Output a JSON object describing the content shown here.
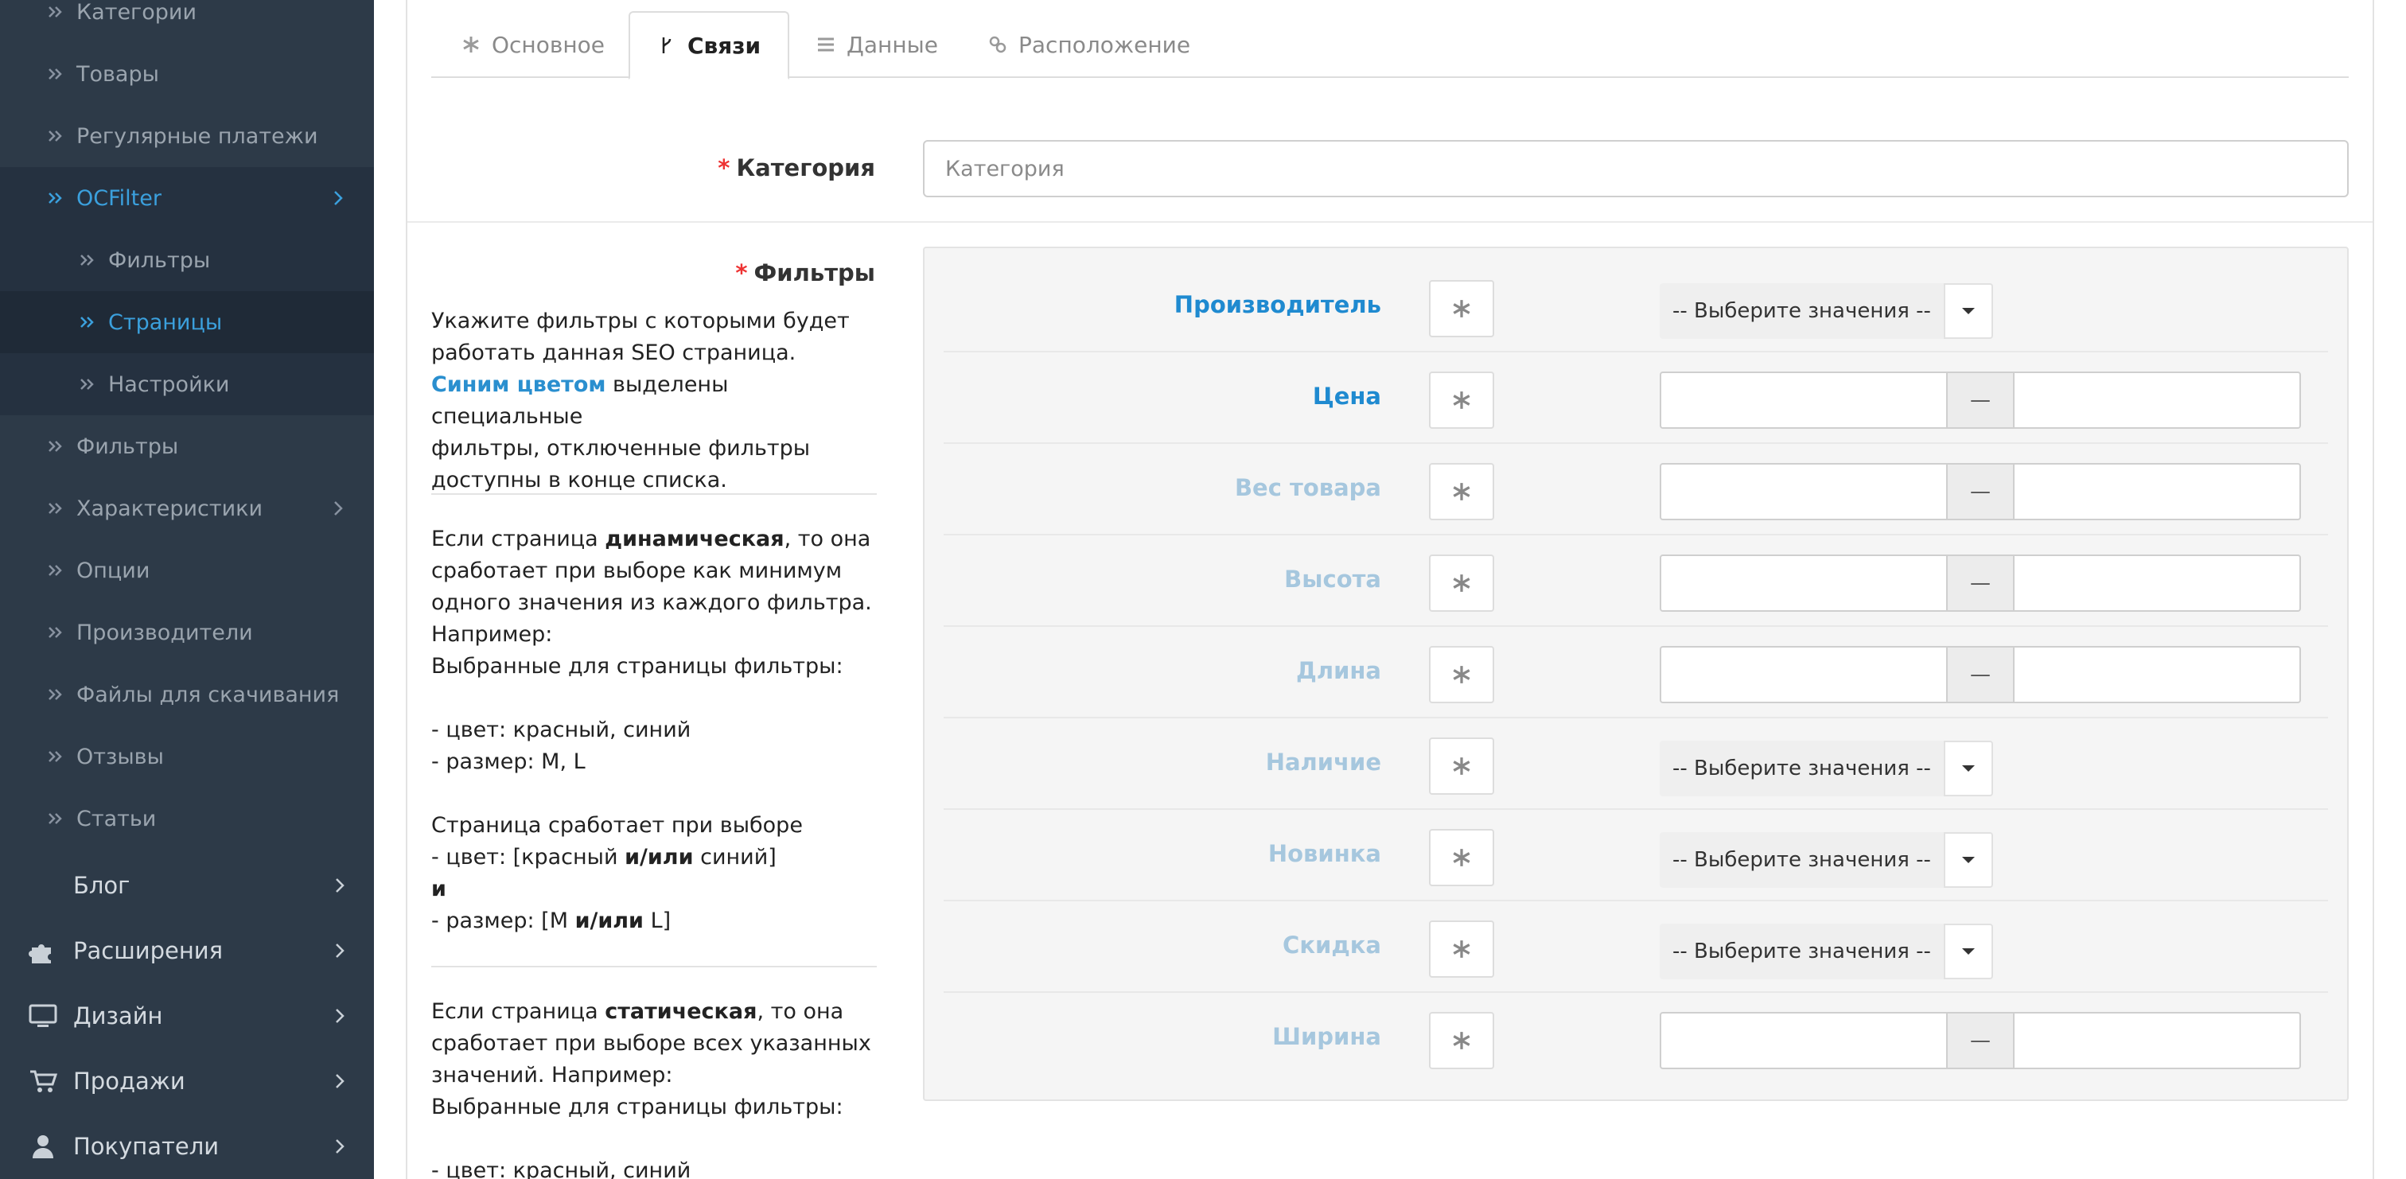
{
  "sidebar": {
    "items": [
      {
        "label": "Категории"
      },
      {
        "label": "Товары"
      },
      {
        "label": "Регулярные платежи"
      },
      {
        "label": "OCFilter"
      },
      {
        "label": "Фильтры"
      },
      {
        "label": "Страницы"
      },
      {
        "label": "Настройки"
      },
      {
        "label": "Фильтры"
      },
      {
        "label": "Характеристики"
      },
      {
        "label": "Опции"
      },
      {
        "label": "Производители"
      },
      {
        "label": "Файлы для скачивания"
      },
      {
        "label": "Отзывы"
      },
      {
        "label": "Статьи"
      }
    ],
    "main": [
      {
        "label": "Блог",
        "icon": "none"
      },
      {
        "label": "Расширения",
        "icon": "puzzle-icon"
      },
      {
        "label": "Дизайн",
        "icon": "monitor-icon"
      },
      {
        "label": "Продажи",
        "icon": "cart-icon"
      },
      {
        "label": "Покупатели",
        "icon": "user-icon"
      }
    ]
  },
  "tabs": [
    {
      "label": "Основное",
      "icon": "asterisk-icon"
    },
    {
      "label": "Связи",
      "icon": "branch-icon"
    },
    {
      "label": "Данные",
      "icon": "list-icon"
    },
    {
      "label": "Расположение",
      "icon": "link-icon"
    }
  ],
  "category": {
    "label": "Категория",
    "placeholder": "Категория",
    "required_mark": "*"
  },
  "filters": {
    "label": "Фильтры",
    "required_mark": "*",
    "description": {
      "p1_line1": "Укажите фильтры с которыми будет",
      "p1_line2": "работать данная SEO страница.",
      "p1_blue": "Синим цветом",
      "p1_line3_rest": " выделены специальные",
      "p1_line4": "фильтры, отключенные фильтры",
      "p1_line5": "доступны в конце списка.",
      "d_prefix": "Если страница ",
      "d_bold": "динамическая",
      "d_suffix": ", то она",
      "d_line2": "сработает при выборе как минимум",
      "d_line3": "одного значения из каждого фильтра.",
      "d_line4": "Например:",
      "d_line5": "Выбранные для страницы фильтры:",
      "d_line6": "- цвет: красный, синий",
      "d_line7": "- размер: M, L",
      "d_line8": "Страница сработает при выборе",
      "d_line9_a": "- цвет: [красный ",
      "d_line9_b": "и/или",
      "d_line9_c": " синий]",
      "d_line10": "и",
      "d_line11_a": "- размер: [M ",
      "d_line11_b": "и/или",
      "d_line11_c": " L]",
      "s_prefix": "Если страница ",
      "s_bold": "статическая",
      "s_suffix": ", то она",
      "s_line2": "сработает при выборе всех указанных",
      "s_line3": "значений. Например:",
      "s_line4": "Выбранные для страницы фильтры:",
      "s_line5": "- цвет: красный, синий"
    },
    "select_placeholder": "-- Выберите значения --",
    "range_separator": "—",
    "rows": [
      {
        "name": "Производитель",
        "state": "special",
        "control": "select"
      },
      {
        "name": "Цена",
        "state": "special",
        "control": "range"
      },
      {
        "name": "Вес товара",
        "state": "disabled",
        "control": "range"
      },
      {
        "name": "Высота",
        "state": "disabled",
        "control": "range"
      },
      {
        "name": "Длина",
        "state": "disabled",
        "control": "range"
      },
      {
        "name": "Наличие",
        "state": "disabled",
        "control": "select"
      },
      {
        "name": "Новинка",
        "state": "disabled",
        "control": "select"
      },
      {
        "name": "Скидка",
        "state": "disabled",
        "control": "select"
      },
      {
        "name": "Ширина",
        "state": "disabled",
        "control": "range"
      }
    ]
  },
  "colors": {
    "sidebar_bg": "#2d3a48",
    "accent": "#3ba0dd",
    "special_filter": "#1f8ad0",
    "disabled_filter": "#a6c7de",
    "required": "#e33333"
  }
}
